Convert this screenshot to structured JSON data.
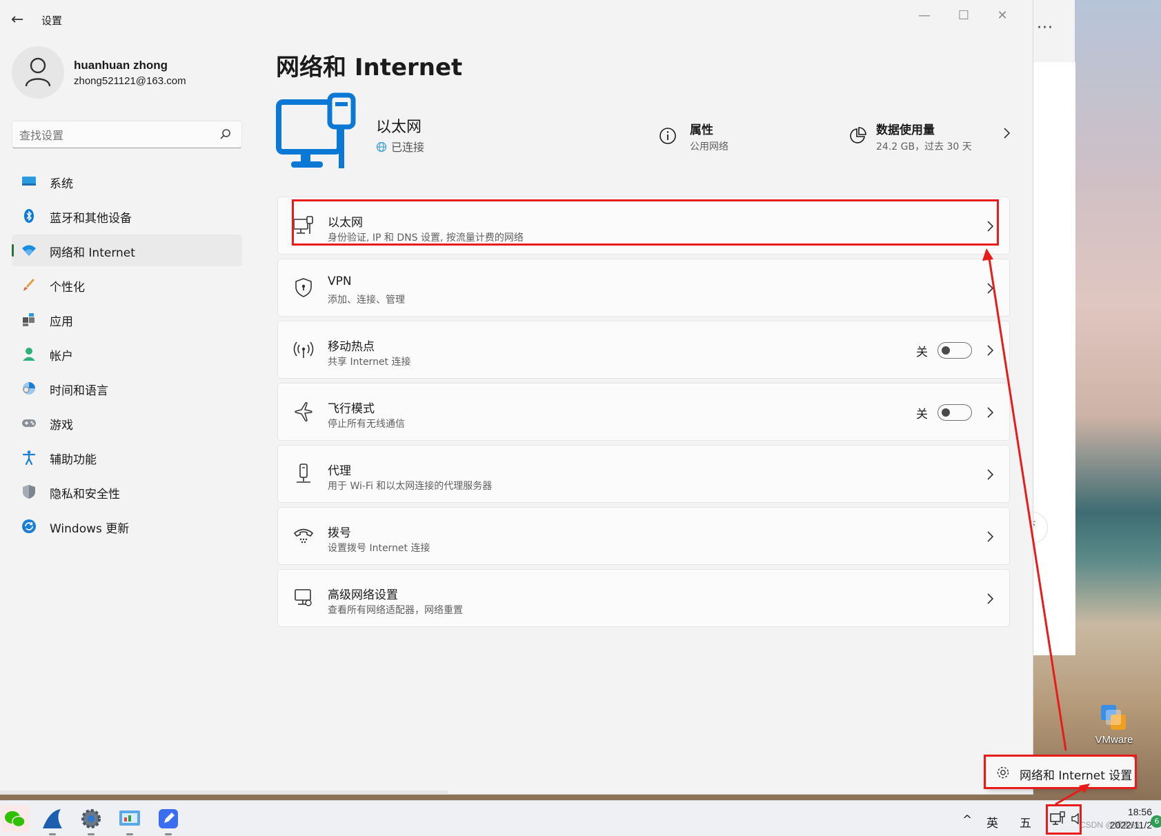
{
  "window": {
    "title": "设置",
    "back": "←",
    "minimize": "—",
    "maximize": "☐",
    "close": "✕"
  },
  "user": {
    "name": "huanhuan zhong",
    "email": "zhong521121@163.com"
  },
  "search": {
    "placeholder": "查找设置"
  },
  "nav": {
    "items": [
      {
        "label": "系统",
        "icon": "system-icon"
      },
      {
        "label": "蓝牙和其他设备",
        "icon": "bluetooth-icon"
      },
      {
        "label": "网络和 Internet",
        "icon": "wifi-icon",
        "active": true
      },
      {
        "label": "个性化",
        "icon": "brush-icon"
      },
      {
        "label": "应用",
        "icon": "apps-icon"
      },
      {
        "label": "帐户",
        "icon": "account-icon"
      },
      {
        "label": "时间和语言",
        "icon": "time-language-icon"
      },
      {
        "label": "游戏",
        "icon": "gamepad-icon"
      },
      {
        "label": "辅助功能",
        "icon": "accessibility-icon"
      },
      {
        "label": "隐私和安全性",
        "icon": "shield-icon"
      },
      {
        "label": "Windows 更新",
        "icon": "update-icon"
      }
    ]
  },
  "page": {
    "title": "网络和 Internet",
    "hero": {
      "name": "以太网",
      "status": "已连接",
      "properties": {
        "title": "属性",
        "sub": "公用网络"
      },
      "usage": {
        "title": "数据使用量",
        "sub": "24.2 GB，过去 30 天"
      }
    },
    "cards": [
      {
        "title": "以太网",
        "sub": "身份验证, IP 和 DNS 设置, 按流量计费的网络",
        "icon": "ethernet-icon"
      },
      {
        "title": "VPN",
        "sub": "添加、连接、管理",
        "icon": "vpn-shield-icon"
      },
      {
        "title": "移动热点",
        "sub": "共享 Internet 连接",
        "icon": "hotspot-icon",
        "toggle": "关",
        "toggle_on": false
      },
      {
        "title": "飞行模式",
        "sub": "停止所有无线通信",
        "icon": "airplane-icon",
        "toggle": "关",
        "toggle_on": false
      },
      {
        "title": "代理",
        "sub": "用于 Wi-Fi 和以太网连接的代理服务器",
        "icon": "proxy-icon"
      },
      {
        "title": "拨号",
        "sub": "设置拨号 Internet 连接",
        "icon": "dialup-icon"
      },
      {
        "title": "高级网络设置",
        "sub": "查看所有网络适配器，网络重置",
        "icon": "advanced-network-icon"
      }
    ]
  },
  "background_window": {
    "more": "···"
  },
  "desktop": {
    "vmware_label": "VMware"
  },
  "tray_popup": {
    "label": "网络和 Internet 设置"
  },
  "taskbar": {
    "chevron": "^",
    "ime_lang": "英",
    "ime_mode": "五",
    "time": "18:56",
    "date": "2022/11/2",
    "watermark": "CSDN @博客66",
    "notification_count": "6"
  },
  "colors": {
    "accent_blue": "#0078d4",
    "highlight_red": "#e81a1a",
    "active_indicator": "#2c6e3d"
  }
}
